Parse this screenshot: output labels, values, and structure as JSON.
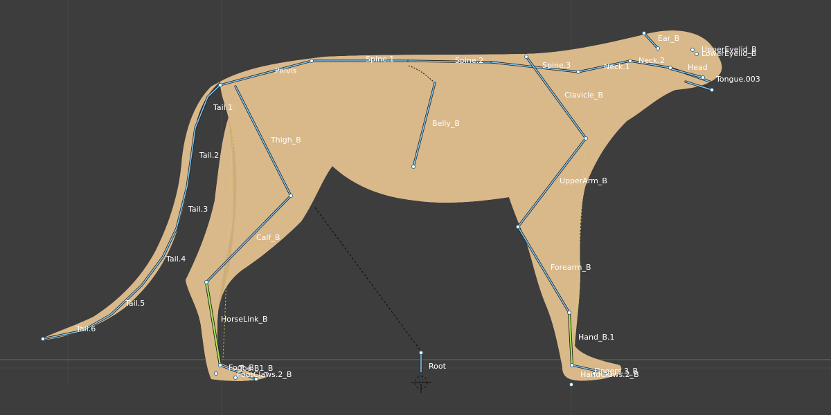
{
  "viewport": {
    "background": "#3d3d3d",
    "grid_color": "#4b5a45",
    "axis_x_color": "#3f5c3f",
    "axis_y_color": "#4e6e4e"
  },
  "colors": {
    "mesh_fill": "#d9b88a",
    "mesh_wire": "#2a2218",
    "spot": "#1b140e",
    "bone_selected": "#a6e35a",
    "bone_default": "#7fc6f2",
    "relationship_line": "#d6d36a"
  },
  "bones": {
    "spine_1": "Spine.1",
    "spine_2": "Spine.2",
    "spine_3": "Spine.3",
    "pelvis": "Pelvis",
    "neck_1": "Neck.1",
    "neck_2": "Neck.2",
    "ear_b": "Ear_B",
    "upper_eyelid_b": "UpperEyelid_B",
    "lower_eyelid_b": "LowerEyelid_B",
    "head": "Head",
    "jaw_tongue": "Tongue.003",
    "clavicle_b": "Clavicle_B",
    "belly_b": "Belly_B",
    "tail_1": "Tail.1",
    "tail_2": "Tail.2",
    "tail_3": "Tail.3",
    "tail_4": "Tail.4",
    "tail_5": "Tail.5",
    "tail_6": "Tail.6",
    "thigh_b": "Thigh_B",
    "calf_b": "Calf_B",
    "horselink_b": "HorseLink_B",
    "foot_b": "Foot_B",
    "toe_b": "Toe.B1_B",
    "foot_claws": "FootClaws.2_B",
    "upperarm_b": "UpperArm_B",
    "forearm_b": "Forearm_B",
    "hand_b": "Hand_B.1",
    "hand_claws": "HandClaws.2_B",
    "fingers": "Fingers.3_B",
    "root": "Root"
  }
}
